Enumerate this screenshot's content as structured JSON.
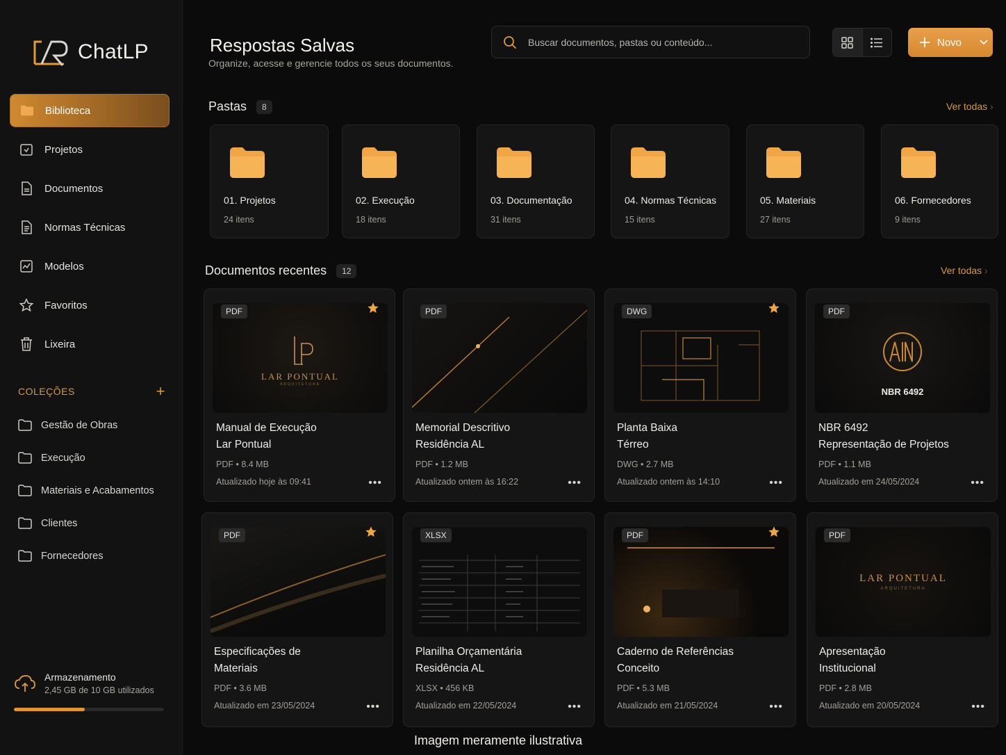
{
  "app": {
    "name": "ChatLP"
  },
  "sidebar": {
    "items": [
      {
        "label": "Biblioteca",
        "icon": "folder-icon",
        "active": true
      },
      {
        "label": "Projetos",
        "icon": "folder-project-icon"
      },
      {
        "label": "Documentos",
        "icon": "document-icon"
      },
      {
        "label": "Normas Técnicas",
        "icon": "norms-icon"
      },
      {
        "label": "Modelos",
        "icon": "template-icon"
      },
      {
        "label": "Favoritos",
        "icon": "star-icon"
      },
      {
        "label": "Lixeira",
        "icon": "trash-icon"
      }
    ],
    "collections_title": "COLEÇÕES",
    "collections": [
      "Gestão de Obras",
      "Execução",
      "Materiais e Acabamentos",
      "Clientes",
      "Fornecedores"
    ],
    "storage": {
      "title": "Armazenamento",
      "usage": "2,45 GB de 10 GB utilizados",
      "fraction": 0.47
    }
  },
  "header": {
    "title": "Respostas Salvas",
    "subtitle": "Organize, acesse e gerencie todos os seus documentos.",
    "search_placeholder": "Buscar documentos, pastas ou conteúdo...",
    "new_button": "Novo"
  },
  "folders_section": {
    "title": "Pastas",
    "count": "8",
    "see_all": "Ver todas",
    "items": [
      {
        "name": "01. Projetos",
        "count": "24 itens"
      },
      {
        "name": "02. Execução",
        "count": "18 itens"
      },
      {
        "name": "03. Documentação",
        "count": "31 itens"
      },
      {
        "name": "04. Normas Técnicas",
        "count": "15 itens"
      },
      {
        "name": "05. Materiais",
        "count": "27 itens"
      },
      {
        "name": "06. Fornecedores",
        "count": "9 itens"
      }
    ]
  },
  "recent_section": {
    "title": "Documentos recentes",
    "count": "12",
    "see_all": "Ver todas",
    "docs": [
      {
        "tag": "PDF",
        "line1": "Manual de Execução",
        "line2": "Lar Pontual",
        "meta": "PDF • 8.4 MB",
        "updated": "Atualizado hoje às 09:41",
        "starred": true,
        "thumb_text": "LAR PONTUAL",
        "thumb_sub": "ARQUITETURA"
      },
      {
        "tag": "PDF",
        "line1": "Memorial Descritivo",
        "line2": "Residência AL",
        "meta": "PDF • 1.2 MB",
        "updated": "Atualizado ontem às 16:22",
        "starred": false
      },
      {
        "tag": "DWG",
        "line1": "Planta Baixa",
        "line2": "Térreo",
        "meta": "DWG • 2.7 MB",
        "updated": "Atualizado ontem às 14:10",
        "starred": true
      },
      {
        "tag": "PDF",
        "line1": "NBR 6492",
        "line2": "Representação de Projetos",
        "meta": "PDF • 1.1 MB",
        "updated": "Atualizado em 24/05/2024",
        "starred": false,
        "thumb_text": "NBR 6492"
      },
      {
        "tag": "PDF",
        "line1": "Especificações de",
        "line2": "Materiais",
        "meta": "PDF • 3.6 MB",
        "updated": "Atualizado em 23/05/2024",
        "starred": true
      },
      {
        "tag": "XLSX",
        "line1": "Planilha Orçamentária",
        "line2": "Residência AL",
        "meta": "XLSX • 456 KB",
        "updated": "Atualizado em 22/05/2024",
        "starred": false
      },
      {
        "tag": "PDF",
        "line1": "Caderno de Referências",
        "line2": "Conceito",
        "meta": "PDF • 5.3 MB",
        "updated": "Atualizado em 21/05/2024",
        "starred": true
      },
      {
        "tag": "PDF",
        "line1": "Apresentação",
        "line2": "Institucional",
        "meta": "PDF • 2.8 MB",
        "updated": "Atualizado em 20/05/2024",
        "starred": false,
        "thumb_text": "LAR PONTUAL",
        "thumb_sub": "ARQUITETURA"
      }
    ]
  },
  "footnote": "Imagem meramente ilustrativa",
  "colors": {
    "accent": "#e0962f",
    "background": "#0b0b0b",
    "panel": "#151515"
  }
}
